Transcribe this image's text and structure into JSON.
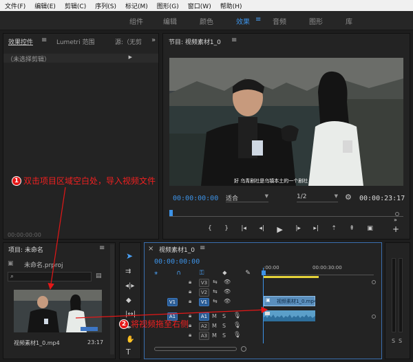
{
  "menu": [
    "文件(F)",
    "编辑(E)",
    "剪辑(C)",
    "序列(S)",
    "标记(M)",
    "图形(G)",
    "窗口(W)",
    "帮助(H)"
  ],
  "workspaces": {
    "tabs": [
      "组件",
      "编辑",
      "颜色",
      "效果",
      "音频",
      "图形",
      "库"
    ],
    "active": "效果"
  },
  "effects_panel": {
    "tabs": [
      "效果控件",
      "Lumetri 范围",
      "源:（无剪"
    ],
    "no_clip": "（未选择剪辑）",
    "timecode": "00:00:00:00"
  },
  "program_monitor": {
    "title": "节目: 视频素材1_0",
    "subtitle": "好  乌青剧社是乌镇本土的一个剧社",
    "timecode": "00:00:00:00",
    "fit": "适合",
    "resolution": "1/2",
    "duration": "00:00:23:17"
  },
  "project_panel": {
    "title": "项目: 未命名",
    "file": "未命名.prproj",
    "clip_name": "视频素材1_0.mp4",
    "clip_duration": "23:17"
  },
  "timeline": {
    "title": "视频素材1_0",
    "timecode": "00:00:00:00",
    "ruler": [
      ":00:00",
      "00:00:30:00"
    ],
    "tracks": [
      {
        "label": "V3",
        "target": ""
      },
      {
        "label": "V2",
        "target": ""
      },
      {
        "label": "V1",
        "target": "V1"
      },
      {
        "label": "A1",
        "target": "A1"
      },
      {
        "label": "A2",
        "target": ""
      },
      {
        "label": "A3",
        "target": ""
      }
    ],
    "video_clip": "视频素材1_0.mp4",
    "mute": "M",
    "solo": "S"
  },
  "meter": {
    "labels": [
      "S",
      "S"
    ]
  },
  "annotations": {
    "step1_num": "1",
    "step1": "双击项目区域空白处，导入视频文件",
    "step2_num": "2",
    "step2": "将视频拖至右侧"
  },
  "colors": {
    "accent": "#3d93e8",
    "annotation": "#e51717",
    "audio_clip": "#5b9fc9"
  }
}
